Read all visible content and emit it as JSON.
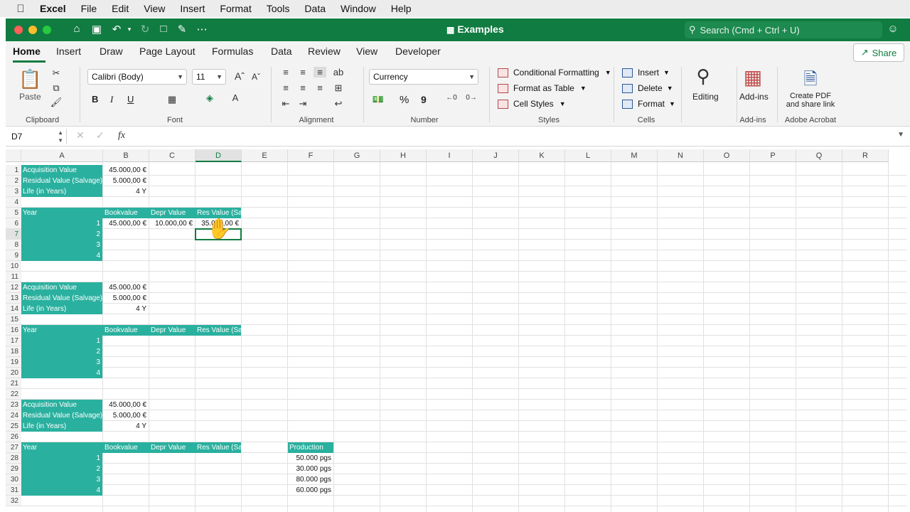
{
  "menubar": {
    "apple_icon": "apple-icon",
    "items": [
      "Excel",
      "File",
      "Edit",
      "View",
      "Insert",
      "Format",
      "Tools",
      "Data",
      "Window",
      "Help"
    ]
  },
  "titlebar": {
    "title": "Examples",
    "search_placeholder": "Search (Cmd + Ctrl + U)",
    "traffic_colors": [
      "#ff5f57",
      "#febc2e",
      "#28c840"
    ]
  },
  "ribbon_tabs": {
    "tabs": [
      "Home",
      "Insert",
      "Draw",
      "Page Layout",
      "Formulas",
      "Data",
      "Review",
      "View",
      "Developer"
    ],
    "active": "Home",
    "share_label": "Share"
  },
  "ribbon": {
    "clipboard": {
      "paste_label": "Paste",
      "group_label": "Clipboard"
    },
    "font": {
      "font_name": "Calibri (Body)",
      "font_size": "11",
      "bold": "B",
      "italic": "I",
      "underline": "U",
      "group_label": "Font"
    },
    "alignment": {
      "group_label": "Alignment"
    },
    "number": {
      "format": "Currency",
      "percent": "%",
      "comma": "9",
      "group_label": "Number"
    },
    "styles": {
      "items": [
        "Conditional Formatting",
        "Format as Table",
        "Cell Styles"
      ],
      "group_label": "Styles"
    },
    "cells": {
      "items": [
        "Insert",
        "Delete",
        "Format"
      ],
      "group_label": "Cells"
    },
    "editing": {
      "label": "Editing"
    },
    "addins": {
      "label": "Add-ins",
      "group_label": "Add-ins"
    },
    "acrobat": {
      "label_line1": "Create PDF",
      "label_line2": "and share link",
      "group_label": "Adobe Acrobat"
    }
  },
  "formula_bar": {
    "name_box": "D7",
    "fx": "fx",
    "content": ""
  },
  "sheet": {
    "columns": [
      "A",
      "B",
      "C",
      "D",
      "E",
      "F",
      "G",
      "H",
      "I",
      "J",
      "K",
      "L",
      "M",
      "N",
      "O",
      "P",
      "Q",
      "R"
    ],
    "selected_column": "D",
    "selected_row": 7,
    "rows": [
      "1",
      "2",
      "3",
      "4",
      "5",
      "6",
      "7",
      "8",
      "9",
      "10",
      "11",
      "12",
      "13",
      "14",
      "15",
      "16",
      "17",
      "18",
      "19",
      "20",
      "21",
      "22",
      "23",
      "24",
      "25",
      "26",
      "27",
      "28",
      "29",
      "30",
      "31",
      "32"
    ],
    "cells": {
      "r1a": "Acquisition Value",
      "r1b": "45.000,00 €",
      "r2a": "Residual Value (Salvage)",
      "r2b": "5.000,00 €",
      "r3a": "Life (in Years)",
      "r3b": "4 Y",
      "r5a": "Year",
      "r5b": "Bookvalue",
      "r5c": "Depr Value",
      "r5d": "Res Value (Salvage)",
      "r6a": "1",
      "r6b": "45.000,00 €",
      "r6c": "10.000,00 €",
      "r6d": "35.000,00 €",
      "r7a": "2",
      "r8a": "3",
      "r9a": "4",
      "r12a": "Acquisition Value",
      "r12b": "45.000,00 €",
      "r13a": "Residual Value (Salvage)",
      "r13b": "5.000,00 €",
      "r14a": "Life (in Years)",
      "r14b": "4 Y",
      "r16a": "Year",
      "r16b": "Bookvalue",
      "r16c": "Depr Value",
      "r16d": "Res Value (Salvage)",
      "r17a": "1",
      "r18a": "2",
      "r19a": "3",
      "r20a": "4",
      "r23a": "Acquisition Value",
      "r23b": "45.000,00 €",
      "r24a": "Residual Value (Salvage)",
      "r24b": "5.000,00 €",
      "r25a": "Life (in Years)",
      "r25b": "4 Y",
      "r27a": "Year",
      "r27b": "Bookvalue",
      "r27c": "Depr Value",
      "r27d": "Res Value (Salvage)",
      "r27f": "Production",
      "r28a": "1",
      "r28f": "50.000 pgs",
      "r29a": "2",
      "r29f": "30.000 pgs",
      "r30a": "3",
      "r30f": "80.000 pgs",
      "r31a": "4",
      "r31f": "60.000 pgs"
    },
    "teal_color": "#2ab09f"
  }
}
